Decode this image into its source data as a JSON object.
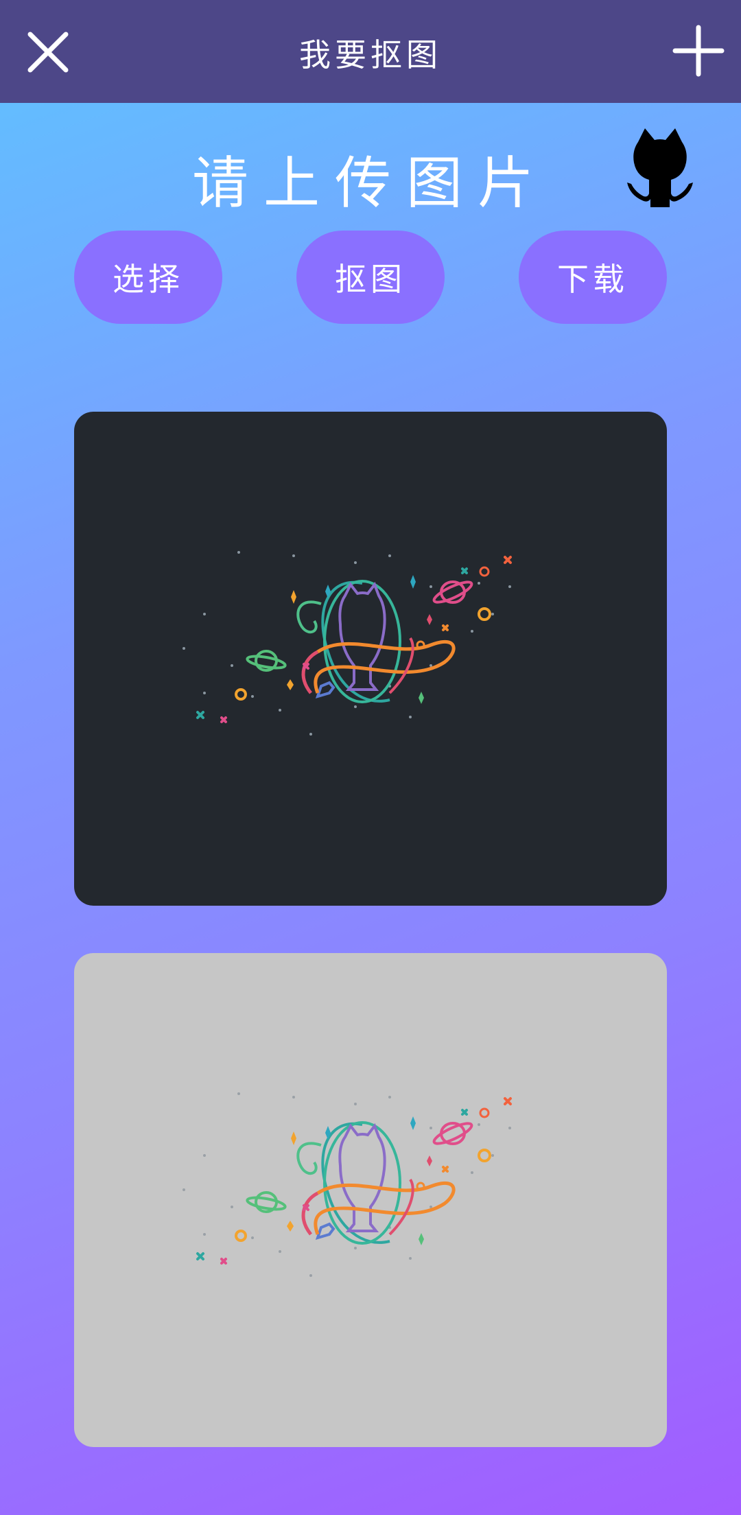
{
  "topbar": {
    "title": "我要抠图",
    "close_icon": "close-icon",
    "add_icon": "plus-icon"
  },
  "header": {
    "headline": "请上传图片",
    "logo_icon": "github-octocat-icon"
  },
  "actions": {
    "select_label": "选择",
    "cutout_label": "抠图",
    "download_label": "下载"
  },
  "panels": {
    "original": {
      "background": "#23282e",
      "content": "github-space-octocat-illustration"
    },
    "result": {
      "background": "#c6c6c6",
      "content": "github-space-octocat-illustration-cutout"
    }
  },
  "colors": {
    "topbar": "#4d4788",
    "button": "#8a70ff",
    "gradient_start": "#5ec3ff",
    "gradient_end": "#a25cff"
  }
}
